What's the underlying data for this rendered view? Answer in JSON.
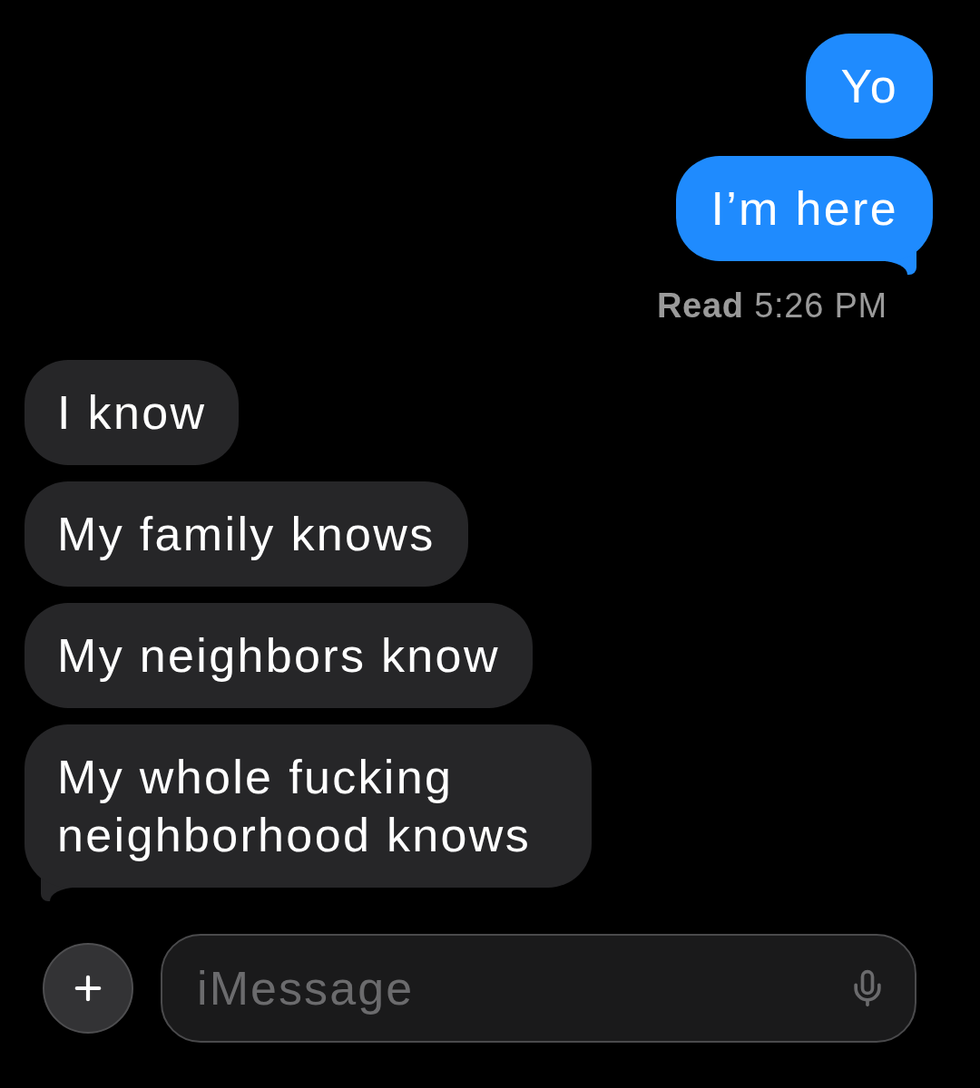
{
  "sent_messages": [
    {
      "text": "Yo",
      "tail": false
    },
    {
      "text": "I’m here",
      "tail": true
    }
  ],
  "read_receipt": "**Read** 5:26 PM",
  "received_messages": [
    {
      "text": "I know",
      "tail": false
    },
    {
      "text": "My family knows",
      "tail": false
    },
    {
      "text": "My neighbors know",
      "tail": false
    },
    {
      "text": "My whole fucking neighborhood knows",
      "tail": true
    }
  ],
  "composer": {
    "placeholder": "iMessage"
  }
}
